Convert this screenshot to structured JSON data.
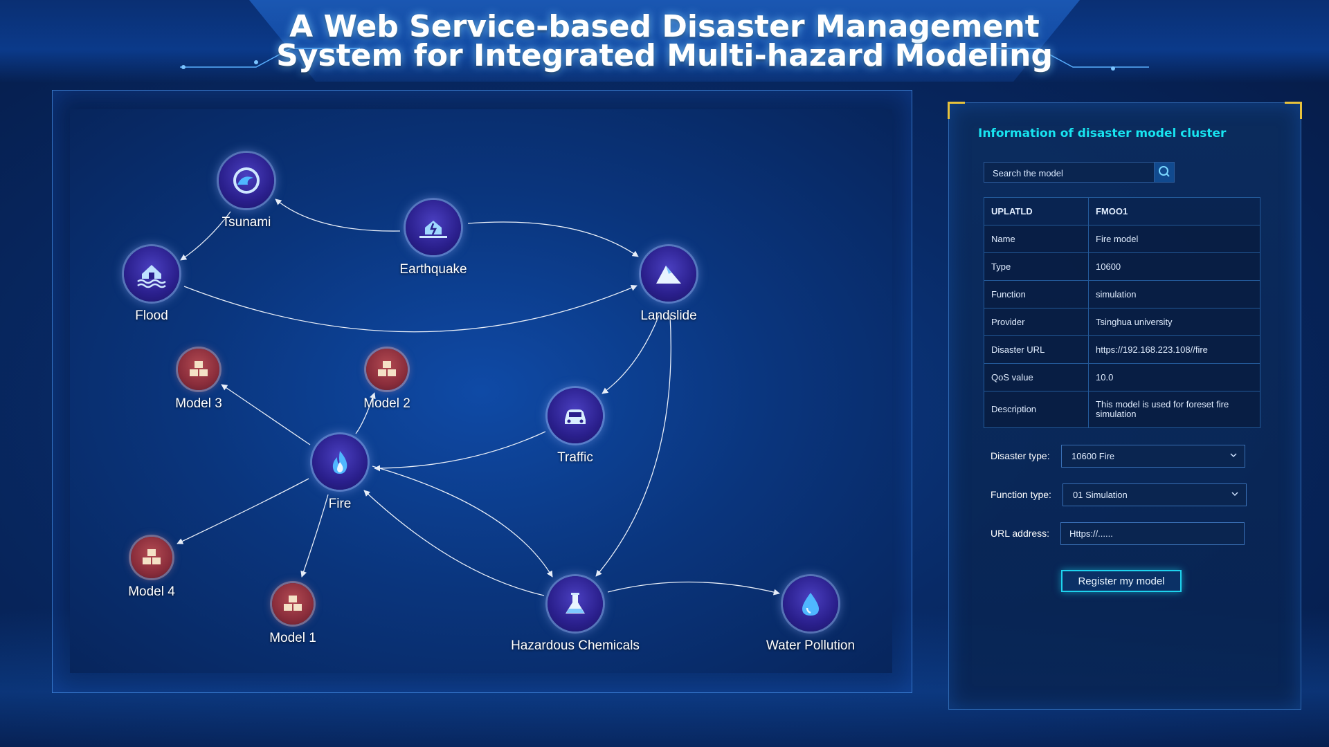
{
  "header": {
    "title_line1": "A Web Service-based Disaster Management",
    "title_line2": "System for Integrated Multi-hazard Modeling"
  },
  "graph": {
    "nodes": {
      "tsunami": {
        "label": "Tsunami",
        "icon": "wave-icon"
      },
      "earthquake": {
        "label": "Earthquake",
        "icon": "earthquake-icon"
      },
      "flood": {
        "label": "Flood",
        "icon": "flood-house-icon"
      },
      "landslide": {
        "label": "Landslide",
        "icon": "landslide-icon"
      },
      "model3": {
        "label": "Model 3",
        "icon": "boxes-icon"
      },
      "model2": {
        "label": "Model 2",
        "icon": "boxes-icon"
      },
      "traffic": {
        "label": "Traffic",
        "icon": "car-icon"
      },
      "fire": {
        "label": "Fire",
        "icon": "flame-icon"
      },
      "model4": {
        "label": "Model 4",
        "icon": "boxes-icon"
      },
      "model1": {
        "label": "Model 1",
        "icon": "boxes-icon"
      },
      "hazchem": {
        "label": "Hazardous Chemicals",
        "icon": "flask-icon"
      },
      "water": {
        "label": "Water Pollution",
        "icon": "droplet-icon"
      }
    },
    "colors": {
      "hazard_node": "#2a1f8c",
      "model_node": "#8a2d3b",
      "edge": "#e8eef8"
    }
  },
  "info_panel": {
    "title": "Information of disaster model cluster",
    "search": {
      "placeholder": "Search the model",
      "icon": "search-icon"
    },
    "table": {
      "header": {
        "key": "UPLATLD",
        "value": "FMOO1"
      },
      "rows": [
        {
          "key": "Name",
          "value": "Fire model"
        },
        {
          "key": "Type",
          "value": "10600"
        },
        {
          "key": "Function",
          "value": "simulation"
        },
        {
          "key": "Provider",
          "value": "Tsinghua university"
        },
        {
          "key": "Disaster URL",
          "value": "https://192.168.223.108//fire"
        },
        {
          "key": "QoS value",
          "value": "10.0"
        },
        {
          "key": "Description",
          "value": "This model is used for foreset fire simulation"
        }
      ]
    },
    "form": {
      "disaster_type_label": "Disaster type:",
      "disaster_type_value": "10600 Fire",
      "function_type_label": "Function type:",
      "function_type_value": "01 Simulation",
      "url_label": "URL address:",
      "url_placeholder": "Https://......"
    },
    "register_label": "Register my model",
    "colors": {
      "accent": "#18e4f0",
      "corner": "#e8c23c"
    }
  }
}
